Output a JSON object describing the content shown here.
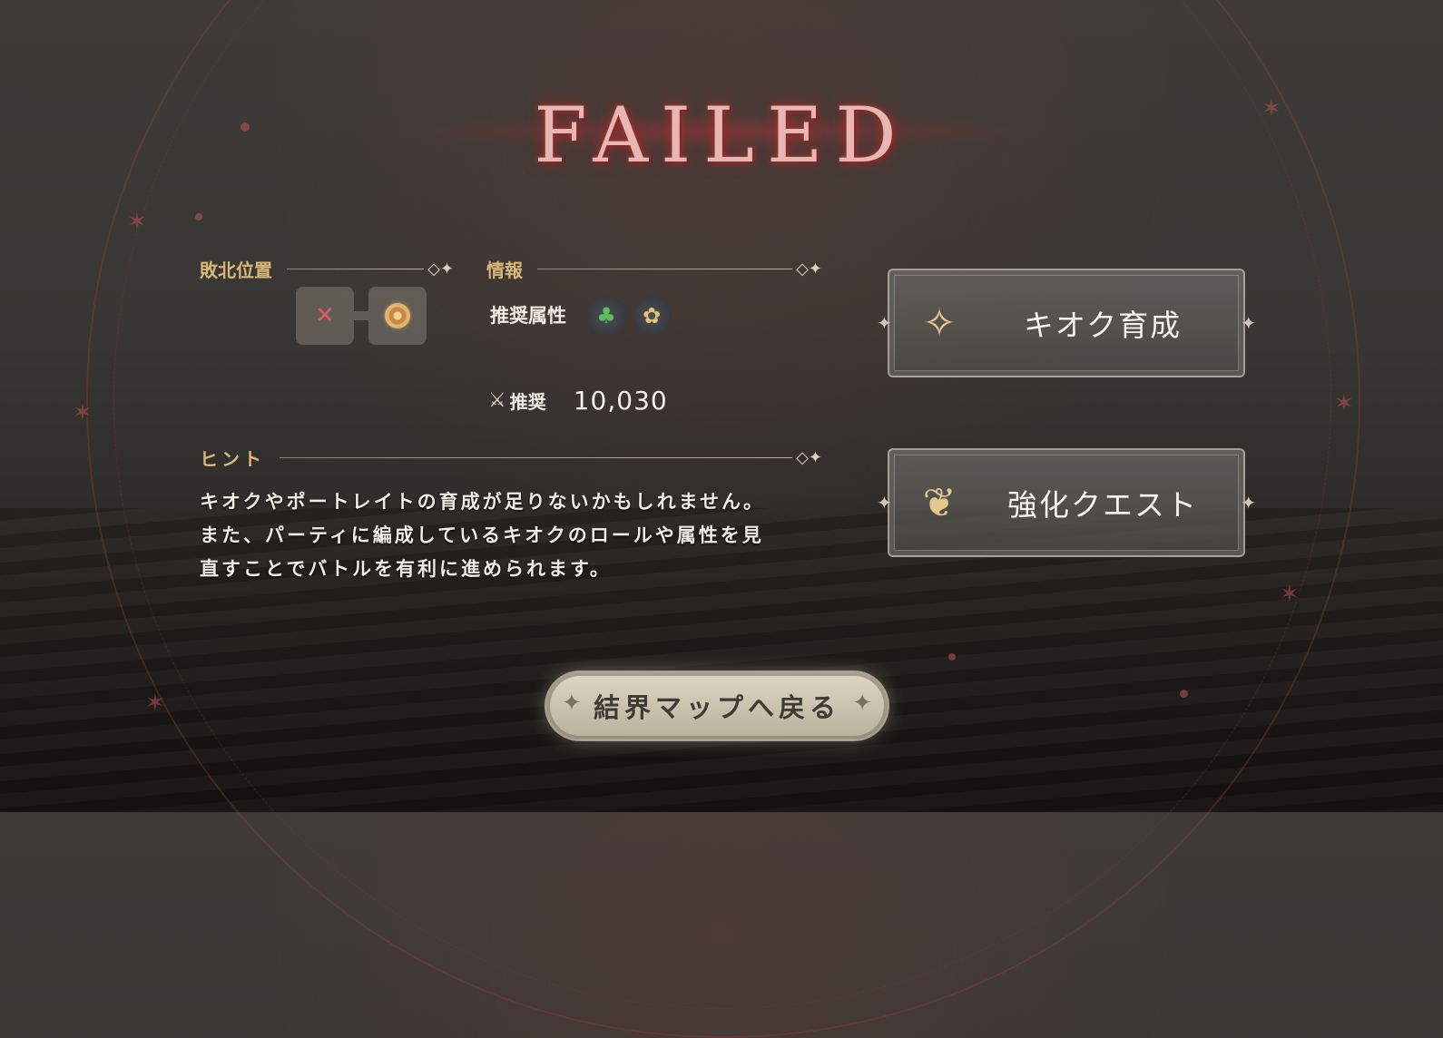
{
  "title": "FAILED",
  "defeat": {
    "label": "敗北位置",
    "slots": [
      {
        "icon": "x-mark-icon",
        "glyph": "✕",
        "state": "defeated"
      },
      {
        "icon": "orb-icon",
        "glyph": "",
        "state": "current"
      }
    ]
  },
  "info": {
    "label": "情報",
    "recommended_attr_label": "推奨属性",
    "attributes": [
      {
        "icon": "leaf-element-icon",
        "glyph": "♣",
        "color": "#5bbf5a"
      },
      {
        "icon": "light-element-icon",
        "glyph": "✿",
        "color": "#e4c074"
      }
    ],
    "power_icon": "crossed-swords-icon",
    "power_label": "推奨",
    "power_value": "10,030"
  },
  "hint": {
    "label": "ヒント",
    "lines": [
      "キオクやポートレイトの育成が足りないかもしれません。",
      "また、パーティに編成しているキオクのロールや属性を見",
      "直すことでバトルを有利に進められます。"
    ]
  },
  "actions": {
    "kioku_training": {
      "label": "キオク育成",
      "icon": "training-figure-icon"
    },
    "enhance_quest": {
      "label": "強化クエスト",
      "icon": "palette-icon"
    }
  },
  "return": {
    "label": "結界マップへ戻る"
  },
  "colors": {
    "accent_gold": "#d8b779",
    "title_red": "#e7b7b3",
    "defeat_red": "#e05a62"
  }
}
